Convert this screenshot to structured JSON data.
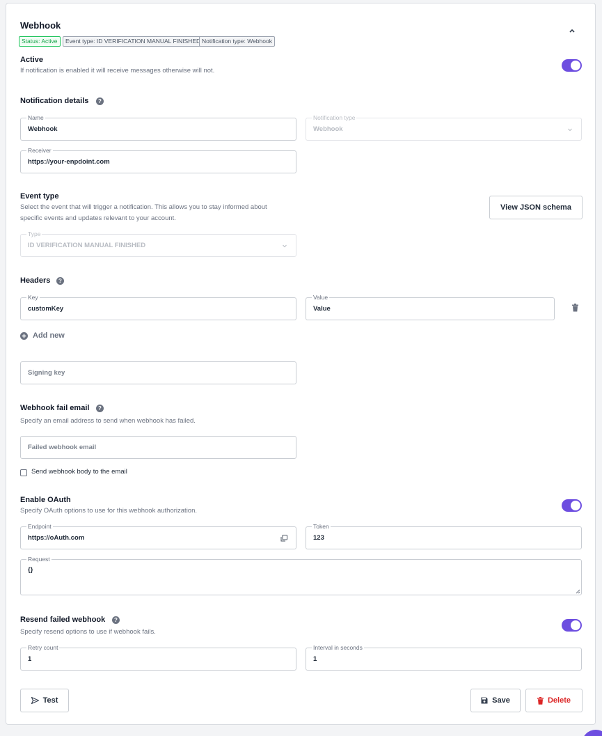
{
  "header": {
    "title": "Webhook",
    "badges": [
      "Status: Active",
      "Event type: ID VERIFICATION MANUAL FINISHED",
      "Notification type: Webhook"
    ]
  },
  "active": {
    "title": "Active",
    "description": "If notification is enabled it will receive messages otherwise will not.",
    "enabled": true
  },
  "details": {
    "title": "Notification details",
    "name_label": "Name",
    "name_value": "Webhook",
    "type_label": "Notification type",
    "type_value": "Webhook",
    "receiver_label": "Receiver",
    "receiver_value": "https://your-enpdoint.com"
  },
  "event": {
    "title": "Event type",
    "description_line1": "Select the event that will trigger a notification. This allows you to stay informed about",
    "description_line2": "specific events and updates relevant to your account.",
    "type_label": "Type",
    "type_value": "ID VERIFICATION MANUAL FINISHED",
    "schema_button": "View JSON schema"
  },
  "headers": {
    "title": "Headers",
    "key_label": "Key",
    "key_value": "customKey",
    "value_label": "Value",
    "value_value": "Value",
    "add_new": "Add new"
  },
  "signing": {
    "placeholder": "Signing key"
  },
  "fail_email": {
    "title": "Webhook fail email",
    "description": "Specify an email address to send when webhook has failed.",
    "placeholder": "Failed webhook email",
    "checkbox_label": "Send webhook body to the email",
    "checked": false
  },
  "oauth": {
    "title": "Enable OAuth",
    "description": "Specify OAuth options to use for this webhook authorization.",
    "enabled": true,
    "endpoint_label": "Endpoint",
    "endpoint_value": "https://oAuth.com",
    "token_label": "Token",
    "token_value": "123",
    "request_label": "Request",
    "request_value": "{}"
  },
  "resend": {
    "title": "Resend failed webhook",
    "description": "Specify resend options to use if webhook fails.",
    "enabled": true,
    "retry_label": "Retry count",
    "retry_value": "1",
    "interval_label": "Interval in seconds",
    "interval_value": "1"
  },
  "actions": {
    "test": "Test",
    "save": "Save",
    "delete": "Delete"
  },
  "colors": {
    "accent": "#6d4ee0",
    "danger": "#dc2626",
    "success": "#16a34a"
  },
  "icons": [
    "chevron-up-icon",
    "help-icon",
    "chevron-down-icon",
    "trash-icon",
    "plus-circle-icon",
    "copy-icon",
    "send-icon",
    "save-icon"
  ]
}
